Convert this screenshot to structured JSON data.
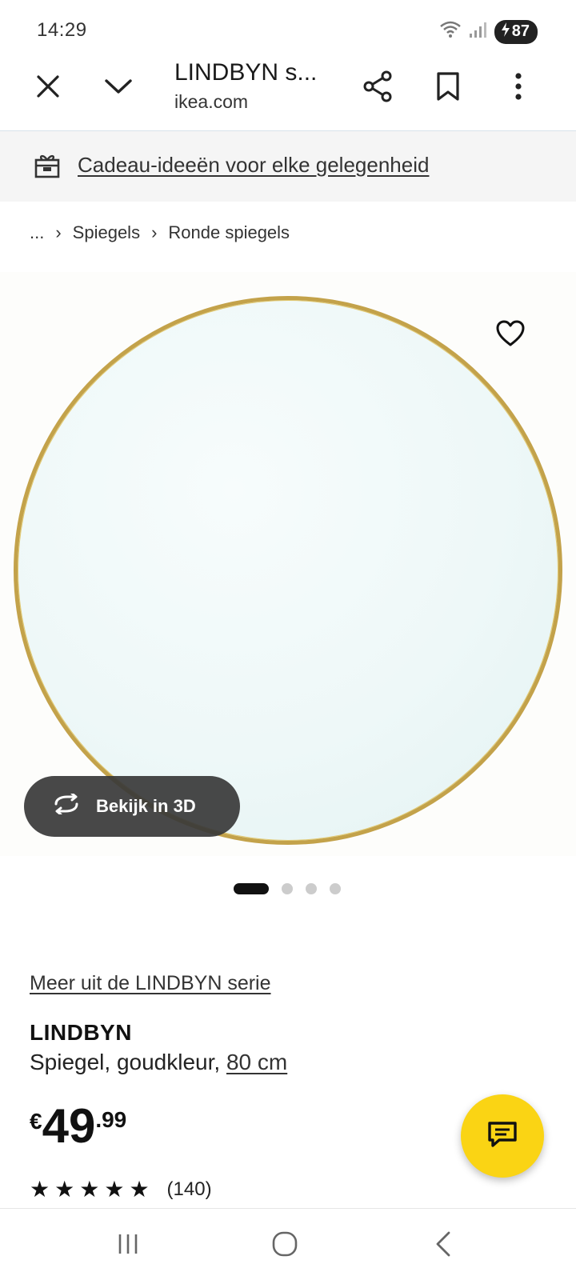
{
  "status_bar": {
    "time": "14:29",
    "battery": "87",
    "icons": [
      "wifi-icon",
      "signal-icon",
      "battery-charging-icon"
    ]
  },
  "browser": {
    "title": "LINDBYN s...",
    "domain": "ikea.com",
    "icons": [
      "close-icon",
      "chevron-down-icon",
      "share-icon",
      "bookmark-icon",
      "more-vert-icon"
    ]
  },
  "promo": {
    "text": "Cadeau-ideeën voor elke gelegenheid",
    "icon": "gift-icon"
  },
  "breadcrumb": {
    "items": [
      "...",
      "Spiegels",
      "Ronde spiegels"
    ]
  },
  "gallery": {
    "view3d_label": "Bekijk in 3D",
    "slides": 4,
    "active_slide": 1
  },
  "product": {
    "series_link": "Meer uit de LINDBYN serie",
    "name": "LINDBYN",
    "desc_prefix": "Spiegel, goudkleur,",
    "size": "80 cm",
    "price_currency": "€",
    "price_int": "49",
    "price_dec": ".99",
    "rating": 5,
    "review_count": "(140)"
  },
  "colors": {
    "accent_yellow": "#fad414",
    "mirror_frame_gold": "#c3a24a",
    "dark_button": "#383838"
  }
}
